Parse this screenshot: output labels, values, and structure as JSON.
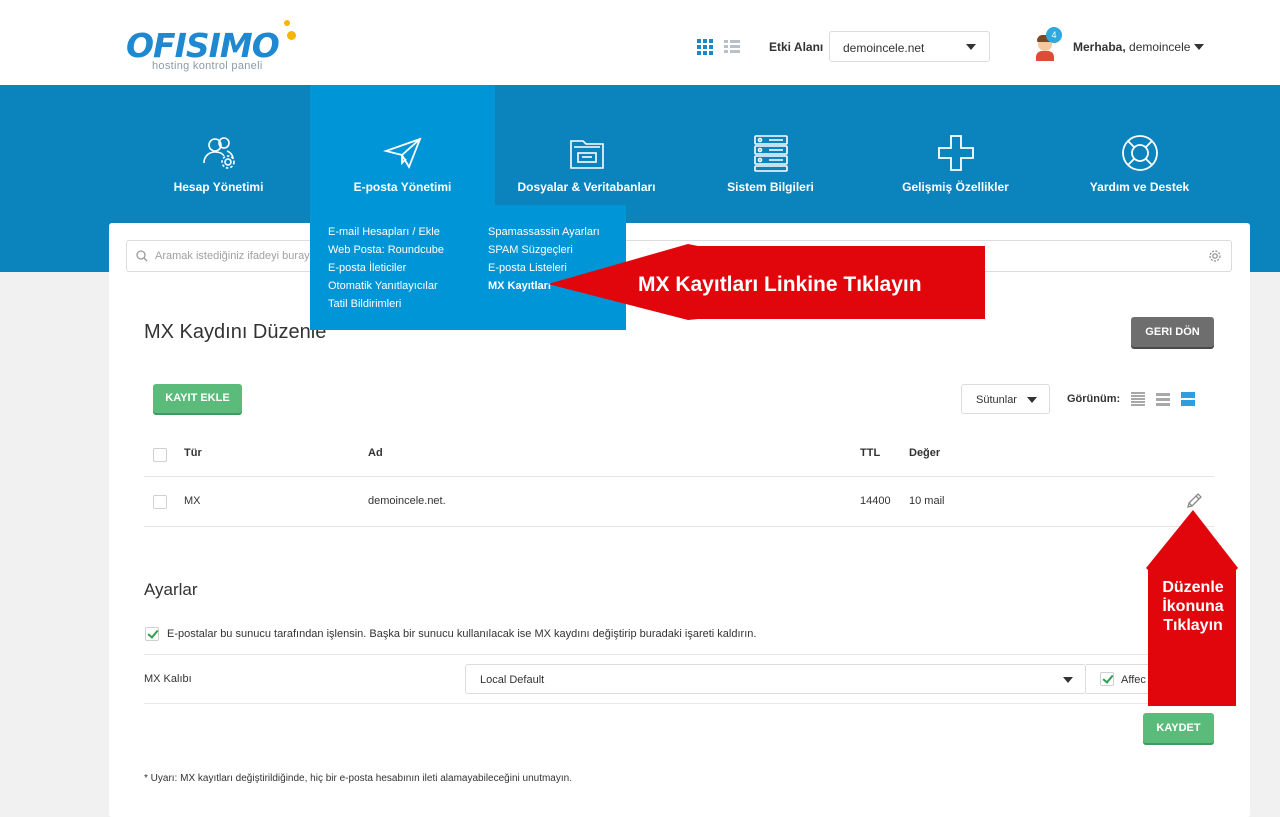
{
  "header": {
    "logo_text": "OFISIMO",
    "logo_sub": "hosting kontrol paneli",
    "domain_label": "Etki Alanı",
    "domain_value": "demoincele.net",
    "badge_count": "4",
    "greeting_bold": "Merhaba,",
    "greeting_user": "demoincele"
  },
  "nav": {
    "items": [
      {
        "label": "Hesap Yönetimi",
        "icon": "users-gear-icon"
      },
      {
        "label": "E-posta Yönetimi",
        "icon": "paper-plane-icon"
      },
      {
        "label": "Dosyalar & Veritabanları",
        "icon": "folder-icon"
      },
      {
        "label": "Sistem Bilgileri",
        "icon": "server-icon"
      },
      {
        "label": "Gelişmiş Özellikler",
        "icon": "plus-icon"
      },
      {
        "label": "Yardım ve Destek",
        "icon": "lifebuoy-icon"
      }
    ]
  },
  "dropdown": {
    "col1": [
      "E-mail Hesapları / Ekle",
      "Web Posta: Roundcube",
      "E-posta İleticiler",
      "Otomatik Yanıtlayıcılar",
      "Tatil Bildirimleri"
    ],
    "col2": [
      "Spamassassin Ayarları",
      "SPAM Süzgeçleri",
      "E-posta Listeleri",
      "MX Kayıtları"
    ]
  },
  "search": {
    "placeholder": "Aramak istediğiniz ifadeyi buraya"
  },
  "page": {
    "title": "MX Kaydını Düzenle",
    "back_button": "GERI DÖN",
    "add_button": "KAYIT EKLE",
    "columns_select": "Sütunlar",
    "view_label": "Görünüm:"
  },
  "table": {
    "headers": {
      "type": "Tür",
      "name": "Ad",
      "ttl": "TTL",
      "value": "Değer"
    },
    "rows": [
      {
        "type": "MX",
        "name": "demoincele.net.",
        "ttl": "14400",
        "value": "10 mail"
      }
    ]
  },
  "settings": {
    "title": "Ayarlar",
    "option_text": "E-postalar bu sunucu tarafından işlensin. Başka bir sunucu kullanılacak ise MX kaydını değiştirip buradaki işareti kaldırın.",
    "mx_label": "MX Kalıbı",
    "mx_value": "Local Default",
    "affect_text": "Affec",
    "save_button": "KAYDET",
    "warning": "* Uyarı: MX kayıtları değiştirildiğinde, hiç bir e-posta hesabının ileti alamayabileceğini unutmayın."
  },
  "annotations": {
    "arrow_left_text": "MX Kayıtları Linkine Tıklayın",
    "arrow_up_text_1": "Düzenle",
    "arrow_up_text_2": "İkonuna",
    "arrow_up_text_3": "Tıklayın",
    "color": "#e0060b"
  },
  "colors": {
    "brand": "#0b84be",
    "active_nav": "#0095d6",
    "green": "#5bbb7a",
    "grey_button": "#6e6e6e"
  }
}
